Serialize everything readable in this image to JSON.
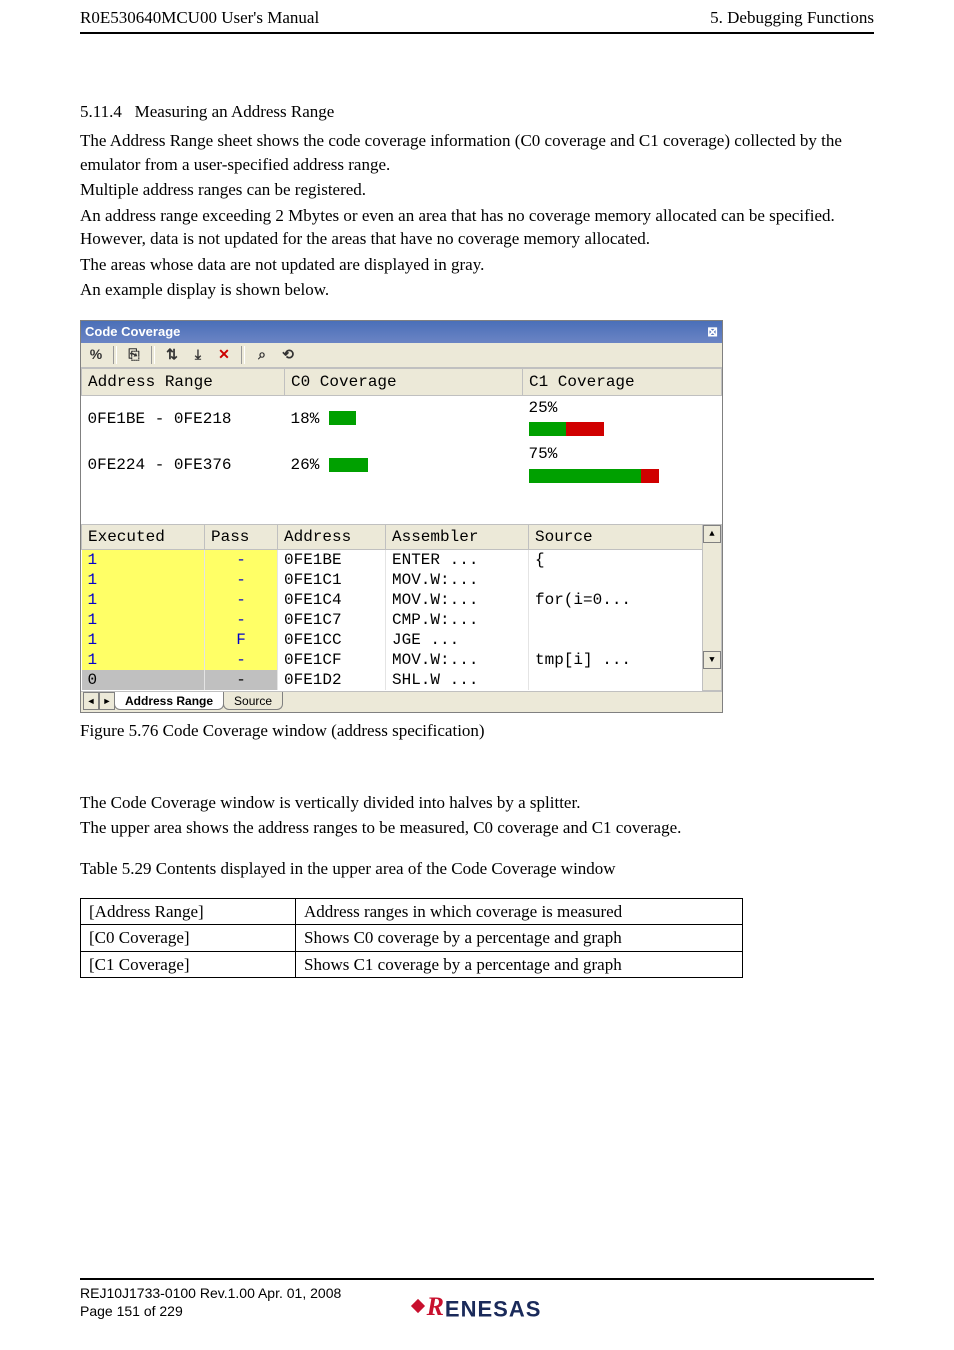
{
  "header": {
    "left": "R0E530640MCU00 User's Manual",
    "right": "5. Debugging Functions"
  },
  "section": {
    "num": "5.11.4",
    "title": "Measuring an Address Range"
  },
  "intro": [
    "The Address Range sheet shows the code coverage information (C0 coverage and C1 coverage) collected by the emulator from a user-specified address range.",
    "Multiple address ranges can be registered.",
    "An address range exceeding 2 Mbytes or even an area that has no coverage memory allocated can be specified. However, data is not updated for the areas that have no coverage memory allocated.",
    "The areas whose data are not updated are displayed in gray.",
    "An example display is shown below."
  ],
  "ccwin": {
    "title": "Code Coverage",
    "close": "⊠",
    "toolbar": {
      "percent": "%",
      "i1": "⎘",
      "i2": "⇅",
      "i3": "⤓",
      "i4": "✕",
      "i5": "⌕",
      "i6": "⟲"
    },
    "upper_headers": {
      "range": "Address Range",
      "c0": "C0 Coverage",
      "c1": "C1 Coverage"
    },
    "ranges": [
      {
        "range": "0FE1BE - 0FE218",
        "c0_label": "18%",
        "c0_pct": 18,
        "c1_label": "25%",
        "c1_pct": 25
      },
      {
        "range": "0FE224 - 0FE376",
        "c0_label": "26%",
        "c0_pct": 26,
        "c1_label": "75%",
        "c1_pct": 75
      }
    ],
    "lower_headers": {
      "executed": "Executed",
      "pass": "Pass",
      "address": "Address",
      "assembler": "Assembler",
      "source": "Source"
    },
    "rows": [
      {
        "executed": "1",
        "pass": "-",
        "address": "0FE1BE",
        "assembler": "ENTER ...",
        "source": "{",
        "gray": false
      },
      {
        "executed": "1",
        "pass": "-",
        "address": "0FE1C1",
        "assembler": "MOV.W:...",
        "source": "",
        "gray": false
      },
      {
        "executed": "1",
        "pass": "-",
        "address": "0FE1C4",
        "assembler": "MOV.W:...",
        "source": "for(i=0...",
        "gray": false
      },
      {
        "executed": "1",
        "pass": "-",
        "address": "0FE1C7",
        "assembler": "CMP.W:...",
        "source": "",
        "gray": false
      },
      {
        "executed": "1",
        "pass": "F",
        "address": "0FE1CC",
        "assembler": "JGE   ...",
        "source": "",
        "gray": false
      },
      {
        "executed": "1",
        "pass": "-",
        "address": "0FE1CF",
        "assembler": "MOV.W:...",
        "source": " tmp[i] ...",
        "gray": false
      },
      {
        "executed": "0",
        "pass": "-",
        "address": "0FE1D2",
        "assembler": "SHL.W ...",
        "source": "",
        "gray": true
      }
    ],
    "tabs": {
      "prev": "◄",
      "next": "►",
      "active": "Address Range",
      "other": "Source"
    }
  },
  "fig_caption": "Figure 5.76 Code Coverage window (address specification)",
  "mid": [
    "The Code Coverage window is vertically divided into halves by a splitter.",
    "The upper area shows the address ranges to be measured, C0 coverage and C1 coverage."
  ],
  "tbl_caption": "Table 5.29 Contents displayed in the upper area of the Code Coverage window",
  "desc_table": [
    {
      "c1": "[Address Range]",
      "c2": "Address ranges in which coverage is measured"
    },
    {
      "c1": "[C0 Coverage]",
      "c2": "Shows C0 coverage by a percentage and graph"
    },
    {
      "c1": "[C1 Coverage]",
      "c2": "Shows C1 coverage by a percentage and graph"
    }
  ],
  "footer": {
    "line1": "REJ10J1733-0100   Rev.1.00   Apr. 01, 2008",
    "line2": "Page 151 of 229",
    "logo": "ENESAS"
  }
}
